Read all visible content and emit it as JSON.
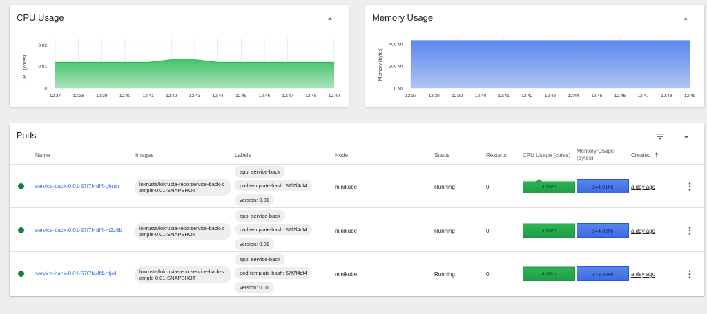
{
  "cpu_card": {
    "title": "CPU Usage",
    "y_axis_label": "CPU (cores)",
    "collapse_icon": "chevron-up-icon"
  },
  "memory_card": {
    "title": "Memory Usage",
    "y_axis_label": "Memory (bytes)",
    "collapse_icon": "chevron-up-icon"
  },
  "chart_data": [
    {
      "type": "area",
      "title": "CPU Usage",
      "ylabel": "CPU (cores)",
      "x": [
        "12:37",
        "12:38",
        "12:39",
        "12:40",
        "12:41",
        "12:42",
        "12:43",
        "12:44",
        "12:45",
        "12:46",
        "12:47",
        "12:48",
        "12:49"
      ],
      "y_ticks": [
        "0",
        "0.01",
        "0.02"
      ],
      "ylim": [
        0,
        0.022
      ],
      "series": [
        {
          "values": [
            0.012,
            0.012,
            0.012,
            0.012,
            0.012,
            0.0132,
            0.0132,
            0.012,
            0.012,
            0.012,
            0.012,
            0.012,
            0.012
          ]
        }
      ],
      "color": "#34a853",
      "grid": true
    },
    {
      "type": "area",
      "title": "Memory Usage",
      "ylabel": "Memory (bytes)",
      "x": [
        "12:37",
        "12:38",
        "12:39",
        "12:40",
        "12:41",
        "12:42",
        "12:43",
        "12:44",
        "12:45",
        "12:46",
        "12:47",
        "12:48",
        "12:49"
      ],
      "y_ticks": [
        "0 Mi",
        "200 Mi",
        "400 Mi"
      ],
      "ylim": [
        0,
        430
      ],
      "series": [
        {
          "values": [
            432,
            432,
            432,
            432,
            432,
            432,
            432,
            432,
            432,
            432,
            432,
            432,
            432
          ]
        }
      ],
      "color": "#3d6be0",
      "grid": true
    }
  ],
  "pods": {
    "title": "Pods",
    "filter_icon": "filter-list-icon",
    "collapse_icon": "chevron-up-icon",
    "columns": {
      "name": "Name",
      "images": "Images",
      "labels": "Labels",
      "node": "Node",
      "status": "Status",
      "restarts": "Restarts",
      "cpu": "CPU Usage (cores)",
      "memory_line1": "Memory Usage",
      "memory_line2": "(bytes)",
      "created": "Created",
      "sort_icon": "arrow-up-icon"
    },
    "rows": [
      {
        "status_icon": "status-running-icon",
        "status_color": "#188038",
        "name": "service-back-0.01-57f7f4df4-ghnjn",
        "image": "lokrusta/lokrusta-repo:service-back-sample-0.01-SNAPSHOT",
        "labels": [
          "app: service-back",
          "pod-template-hash: 57f7f4df4",
          "version: 0.01"
        ],
        "node": "minikube",
        "status": "Running",
        "restarts": "0",
        "cpu": "4.00m",
        "memory": "144.01Mi",
        "created": "a day ago",
        "menu_icon": "more-vert-icon"
      },
      {
        "status_icon": "status-running-icon",
        "status_color": "#188038",
        "name": "service-back-0.01-57f7f4df4-m2z8b",
        "image": "lokrusta/lokrusta-repo:service-back-sample-0.01-SNAPSHOT",
        "labels": [
          "app: service-back",
          "pod-template-hash: 57f7f4df4",
          "version: 0.01"
        ],
        "node": "minikube",
        "status": "Running",
        "restarts": "0",
        "cpu": "4.00m",
        "memory": "144.85Mi",
        "created": "a day ago",
        "menu_icon": "more-vert-icon"
      },
      {
        "status_icon": "status-running-icon",
        "status_color": "#188038",
        "name": "service-back-0.01-57f7f4df4-dtjrd",
        "image": "lokrusta/lokrusta-repo:service-back-sample-0.01-SNAPSHOT",
        "labels": [
          "app: service-back",
          "pod-template-hash: 57f7f4df4",
          "version: 0.01"
        ],
        "node": "minikube",
        "status": "Running",
        "restarts": "0",
        "cpu": "4.00m",
        "memory": "143.86Mi",
        "created": "a day ago",
        "menu_icon": "more-vert-icon"
      }
    ]
  }
}
